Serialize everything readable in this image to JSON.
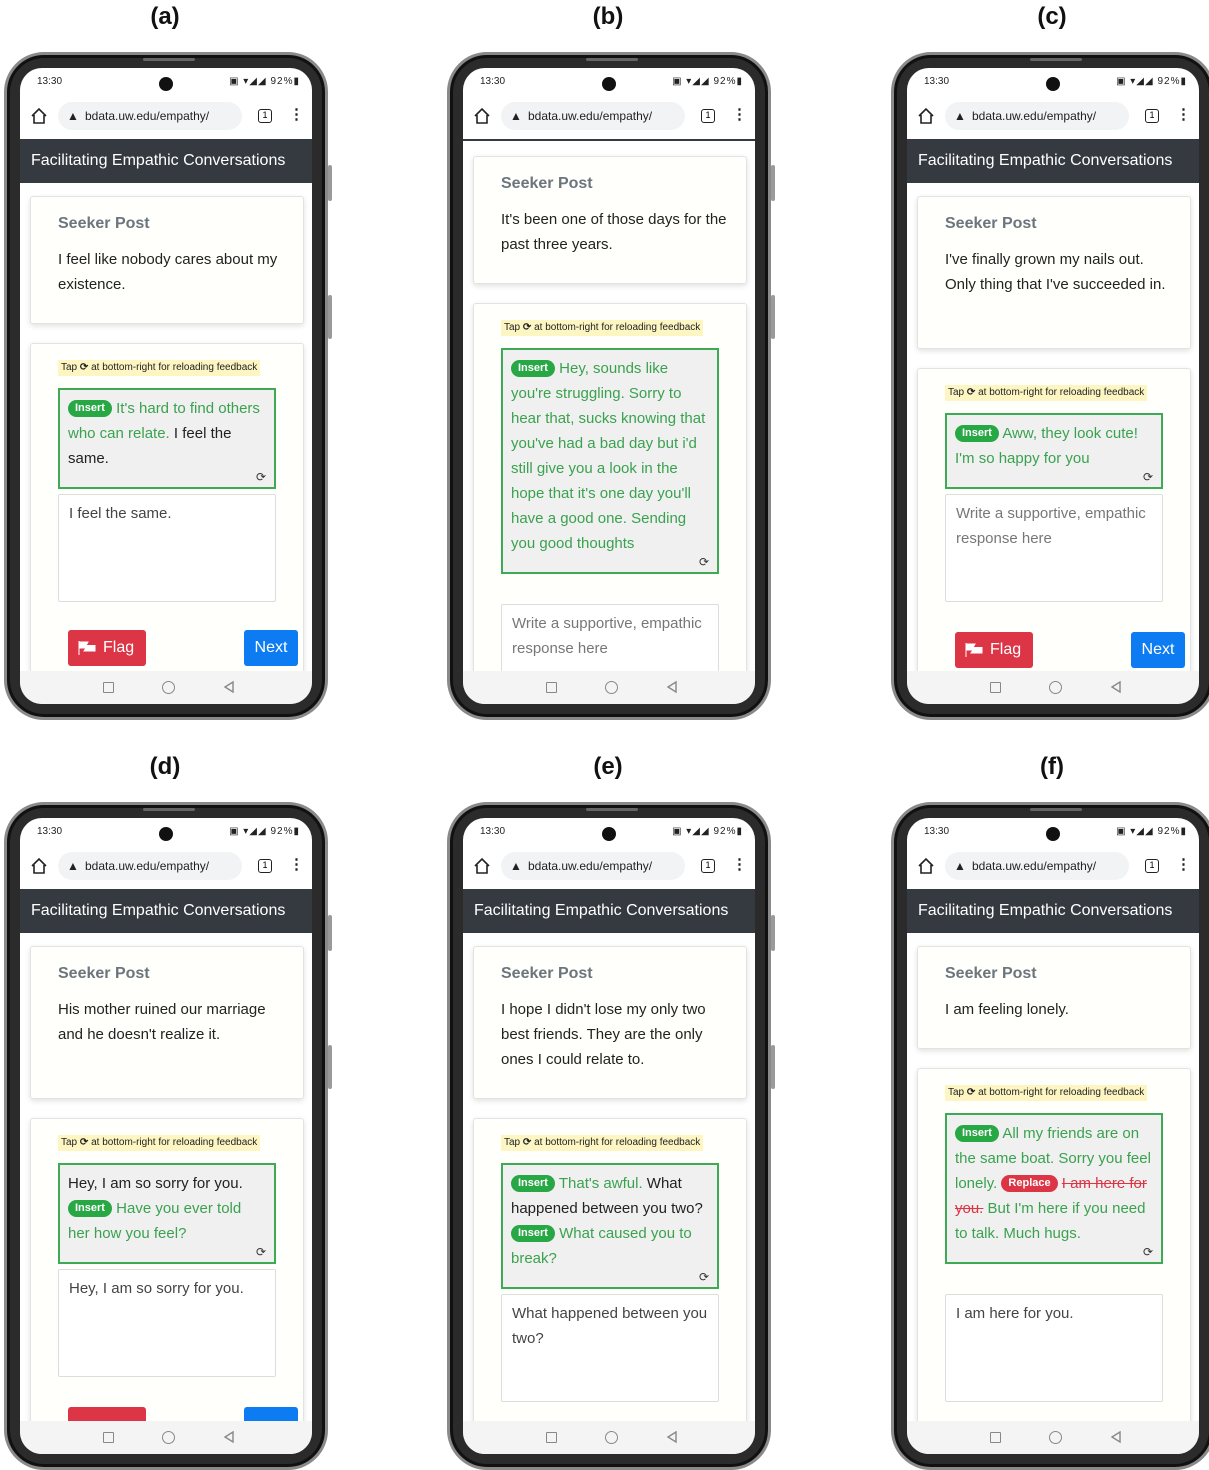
{
  "phone": {
    "status_time": "13:30",
    "status_icons": "▣ ▾◢◢ 92%▮",
    "url": "bdata.uw.edu/empathy/",
    "tab_count": "1",
    "app_title": "Facilitating Empathic Conversations",
    "seeker_label": "Seeker Post",
    "tip_prefix": "Tap",
    "tip_reload": "⟳",
    "tip_suffix": "at bottom-right for reloading feedback",
    "insert_badge": "Insert",
    "replace_badge": "Replace",
    "flag_label": "Flag",
    "next_label": "Next",
    "reload_icon": "⟳",
    "placeholder": "Write a supportive, empathic response here"
  },
  "panels": [
    {
      "label": "(a)",
      "seeker_post": "I feel like nobody cares about my existence.",
      "feedback": {
        "insert_1": "It's hard to find others who can relate.",
        "plain_after": "I feel the same."
      },
      "response": "I feel the same."
    },
    {
      "label": "(b)",
      "seeker_post": "It's been one of those days for the past three years.",
      "feedback": {
        "insert_1": "Hey, sounds like you're struggling. Sorry to hear that, sucks knowing that you've had a bad day but i'd still give you a look in the hope that it's one day you'll have a good one. Sending you good thoughts"
      },
      "response": ""
    },
    {
      "label": "(c)",
      "seeker_post": "I've finally grown my nails out. Only thing that I've succeeded in.",
      "feedback": {
        "insert_1": "Aww, they look cute! I'm so happy for you"
      },
      "response": ""
    },
    {
      "label": "(d)",
      "seeker_post": "His mother ruined our marriage and he doesn't realize it.",
      "feedback": {
        "plain_before": "Hey, I am so sorry for you.",
        "insert_1": "Have you ever told her how you feel?"
      },
      "response": "Hey, I am so sorry for you."
    },
    {
      "label": "(e)",
      "seeker_post": "I hope I didn't lose my only two best friends. They are the only ones I could relate to.",
      "feedback": {
        "insert_1": "That's awful.",
        "plain_mid": "What happened between you two?",
        "insert_2": "What caused you to break?"
      },
      "response": "What happened between you two?"
    },
    {
      "label": "(f)",
      "seeker_post": "I am feeling lonely.",
      "feedback": {
        "insert_1": "All my friends are on the same boat. Sorry you feel lonely.",
        "strike_text": "I am here for you.",
        "replace_text": "But I'm here if you need to talk. Much hugs."
      },
      "response": "I am here for you."
    }
  ]
}
